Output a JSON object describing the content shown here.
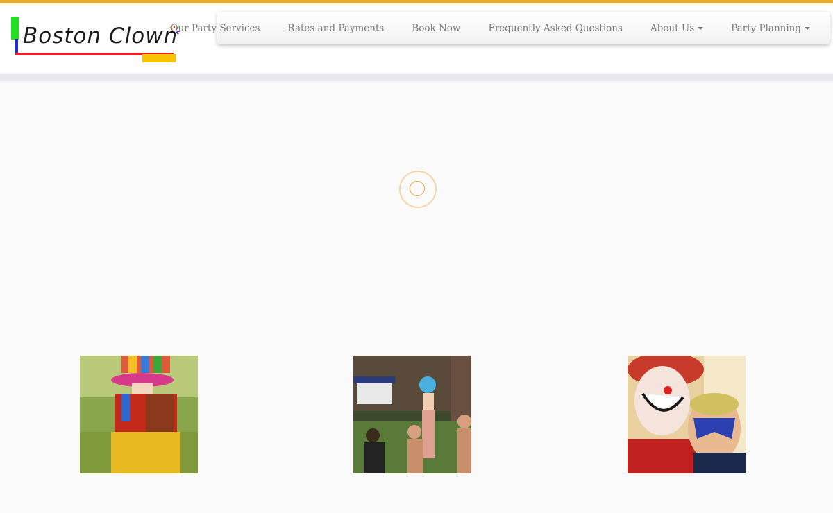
{
  "logo": {
    "text": "Boston Clown"
  },
  "nav": {
    "items": [
      {
        "label": "Our Party Services",
        "dropdown": false
      },
      {
        "label": "Rates and Payments",
        "dropdown": false
      },
      {
        "label": "Book Now",
        "dropdown": false
      },
      {
        "label": "Frequently Asked Questions",
        "dropdown": false
      },
      {
        "label": "About Us",
        "dropdown": true
      },
      {
        "label": "Party Planning",
        "dropdown": true
      }
    ]
  },
  "colors": {
    "accent_bar": "#e8ae31",
    "nav_text": "#777777",
    "loader": "#e7a43c"
  },
  "icons": {
    "loader": "loading-spinner-icon",
    "dropdown": "caret-down-icon"
  }
}
